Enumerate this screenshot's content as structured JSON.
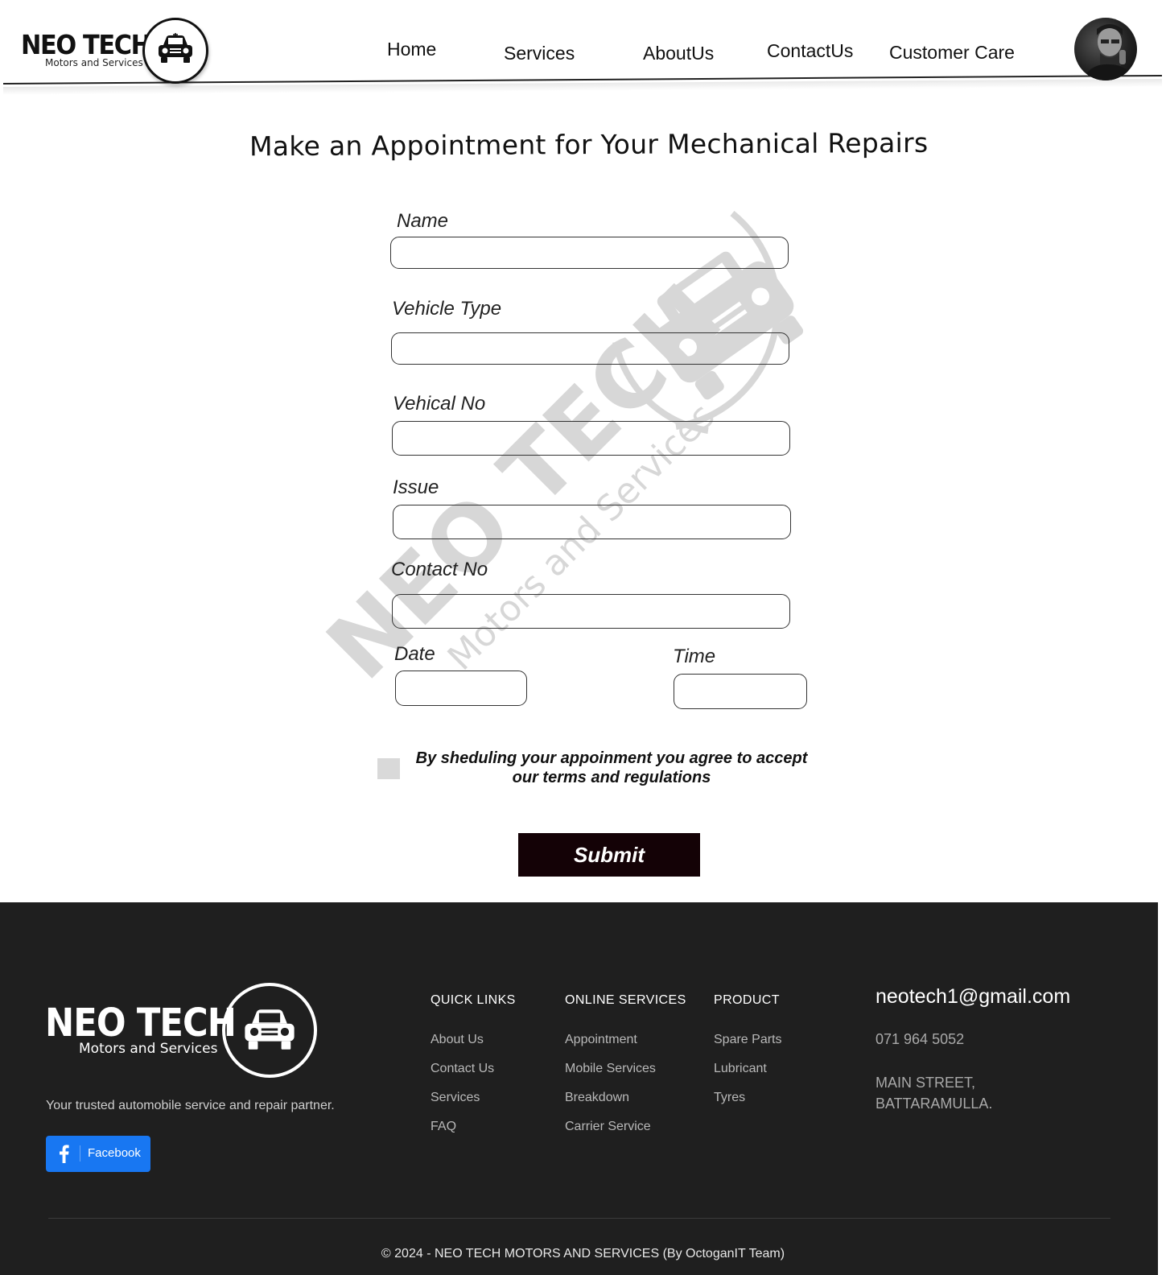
{
  "header": {
    "logo_name": "NEO TECH",
    "logo_sub": "Motors and Services",
    "nav": [
      "Home",
      "Services",
      "AboutUs",
      "ContactUs",
      "Customer Care"
    ]
  },
  "main": {
    "title": "Make an Appointment for Your Mechanical Repairs",
    "fields": {
      "name": "Name",
      "vehicle_type": "Vehicle Type",
      "vehicle_no": "Vehical No",
      "issue": "Issue",
      "contact_no": "Contact No",
      "date": "Date",
      "time": "Time"
    },
    "values": {
      "name": "",
      "vehicle_type": "",
      "vehicle_no": "",
      "issue": "",
      "contact_no": "",
      "date": "",
      "time": ""
    },
    "consent_line1": "By sheduling your appoinment you agree to accept",
    "consent_line2": "our terms and regulations",
    "consent_checked": false,
    "submit_label": "Submit",
    "watermark_name": "NEO TECH",
    "watermark_sub": "Motors and Services"
  },
  "footer": {
    "logo_name": "NEO TECH",
    "logo_sub": "Motors and Services",
    "tagline": "Your trusted automobile service and repair partner.",
    "facebook_label": "Facebook",
    "columns": [
      {
        "title": "QUICK LINKS",
        "links": [
          "About Us",
          "Contact Us",
          "Services",
          "FAQ"
        ]
      },
      {
        "title": "ONLINE SERVICES",
        "links": [
          "Appointment",
          "Mobile Services",
          "Breakdown",
          "Carrier Service"
        ]
      },
      {
        "title": "PRODUCT",
        "links": [
          "Spare Parts",
          "Lubricant",
          "Tyres"
        ]
      }
    ],
    "email": "neotech1@gmail.com",
    "phone": "071 964 5052",
    "address_line1": "MAIN STREET,",
    "address_line2": "BATTARAMULLA.",
    "copyright": "© 2024 - NEO TECH MOTORS AND SERVICES (By OctoganIT Team)"
  },
  "colors": {
    "submit_bg": "#140206",
    "footer_bg": "#1f1f1f",
    "facebook": "#1877f2"
  },
  "icons": [
    "car-icon",
    "user-avatar",
    "facebook-icon"
  ]
}
